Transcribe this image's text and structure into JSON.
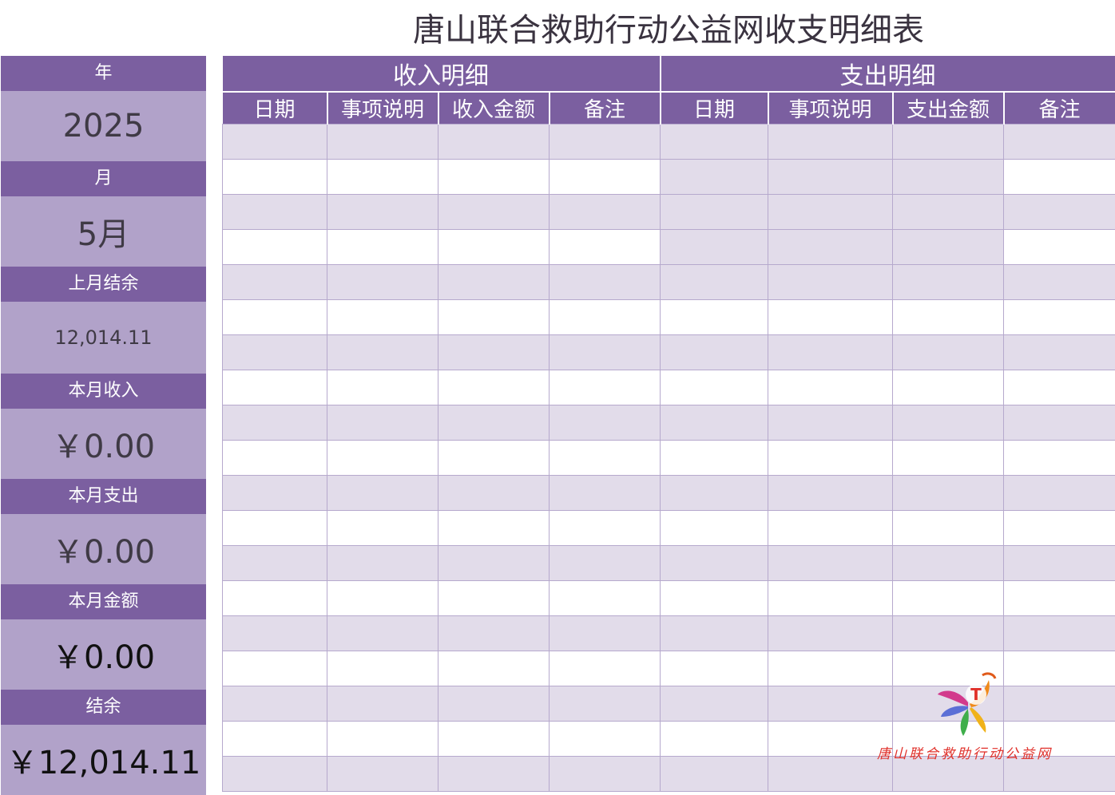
{
  "title": "唐山联合救助行动公益网收支明细表",
  "sidebar": {
    "year_label": "年",
    "year_value": "2025",
    "month_label": "月",
    "month_value": "5月",
    "prev_balance_label": "上月结余",
    "prev_balance_value": "12,014.11",
    "income_label": "本月收入",
    "income_value": "￥0.00",
    "expense_label": "本月支出",
    "expense_value": "￥0.00",
    "amount_label": "本月金额",
    "amount_value": "￥0.00",
    "balance_label": "结余",
    "balance_value": "￥12,014.11"
  },
  "table": {
    "income_group": "收入明细",
    "expense_group": "支出明细",
    "income_columns": [
      "日期",
      "事项说明",
      "收入金额",
      "备注"
    ],
    "expense_columns": [
      "日期",
      "事项说明",
      "支出金额",
      "备注"
    ],
    "row_count": 19
  },
  "logo": {
    "letter": "T",
    "text": "唐山联合救助行动公益网"
  },
  "colors": {
    "header": "#7b5fa0",
    "side_value": "#b1a2c9",
    "row_shade": "#e2dcea"
  }
}
